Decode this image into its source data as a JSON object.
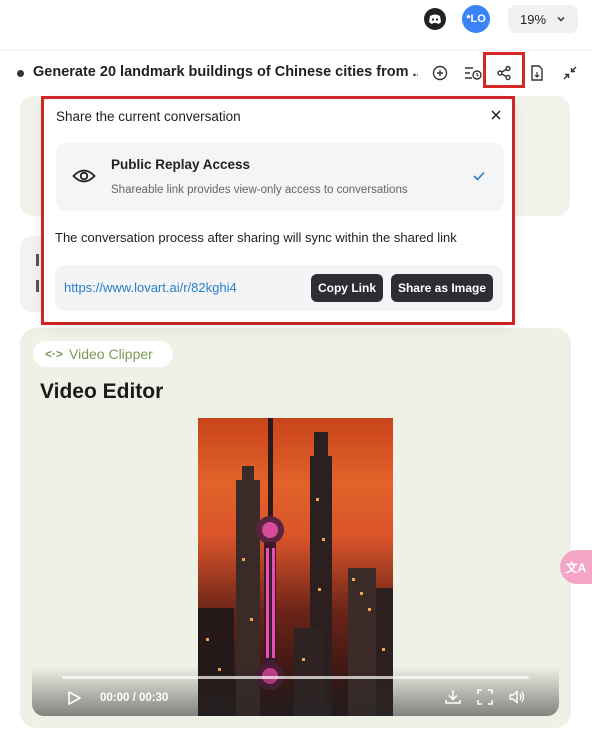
{
  "topbar": {
    "zoom_value": "19%",
    "avatar_initials": "*LO"
  },
  "conversation": {
    "title": "Generate 20 landmark buildings of Chinese cities from ..."
  },
  "share_popup": {
    "title": "Share the current conversation",
    "access_title": "Public Replay Access",
    "access_desc": "Shareable link provides view-only access to conversations",
    "sync_note": "The conversation process after sharing will sync within the shared link",
    "link_url": "https://www.lovart.ai/r/82kghi4",
    "copy_label": "Copy Link",
    "share_image_label": "Share as Image"
  },
  "video_card": {
    "badge": "Video Clipper",
    "badge_icon": "<·>",
    "title": "Video Editor",
    "time": "00:00 / 00:30",
    "progress": 0.0
  },
  "translate_fab": "文A",
  "colors": {
    "highlight": "#d62828",
    "accent_green": "#7b9a54",
    "link_blue": "#2b7fc9",
    "button_dark": "#2c2e33"
  }
}
